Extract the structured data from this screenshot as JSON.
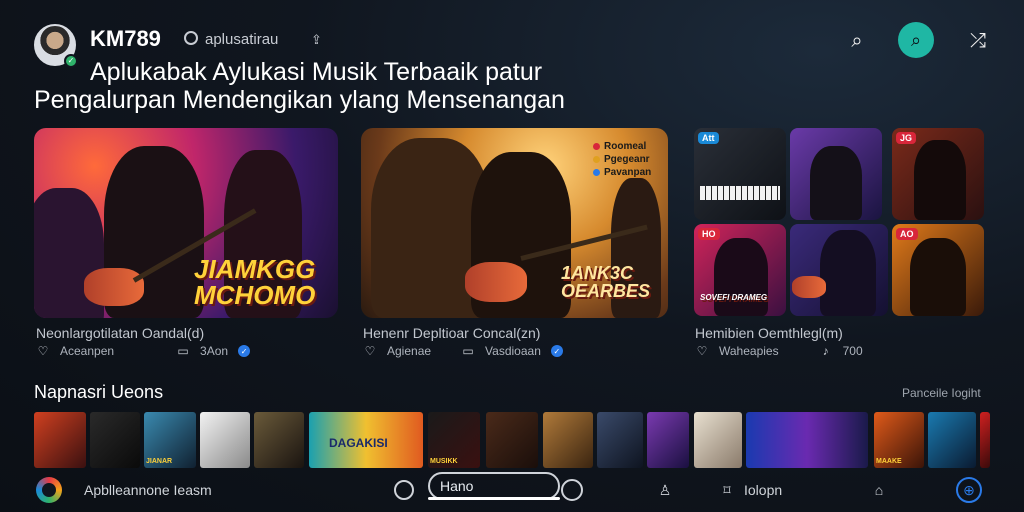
{
  "header": {
    "username": "KM789",
    "tagline": "aplusatirau",
    "headline_line1": "Aplukabak Aylukasi Musik Terbaaik patur",
    "headline_line2": "Pengalurpan Mendengikan ylang Mensenangan",
    "icons": [
      "search-icon",
      "discover-icon",
      "shuffle-icon"
    ]
  },
  "featured": [
    {
      "overlay": "JIAMKGG\nMCHOMO",
      "title": "Neonlargotilatan Oandal(d)",
      "left_meta": "Aceanpen",
      "right_meta": "3Aon"
    },
    {
      "overlay": "1ANK3C\nOEARBES",
      "chip_line1": "Roomeal",
      "chip_line2": "Pgegeanr",
      "chip_line3": "Pavanpan",
      "title": "Henenr Depltioar Concal(zn)",
      "left_meta": "Agienae",
      "right_meta": "Vasdioaan"
    },
    {
      "title": "Hemibien Oemthlegl(m)",
      "left_meta": "Waheapies",
      "right_meta": "700",
      "tiles": [
        {
          "badge": "Att"
        },
        {
          "badge": ""
        },
        {
          "badge": "JG"
        },
        {
          "badge": "HO",
          "label": "SOVEFI DRAMEG"
        },
        {
          "badge": ""
        },
        {
          "badge": "AO"
        }
      ]
    }
  ],
  "section": {
    "title": "Napnasri Ueons",
    "link": "Panceile Iogiht"
  },
  "strip": [
    {
      "label": ""
    },
    {
      "label": ""
    },
    {
      "label": "JIANAR"
    },
    {
      "label": ""
    },
    {
      "label": ""
    },
    {
      "label": "DAGAKISI"
    },
    {
      "label": "MUSIKK"
    },
    {
      "label": ""
    },
    {
      "label": ""
    },
    {
      "label": ""
    },
    {
      "label": ""
    },
    {
      "label": ""
    },
    {
      "label": ""
    },
    {
      "label": "MAAKE"
    },
    {
      "label": ""
    },
    {
      "label": ""
    },
    {
      "label": ""
    }
  ],
  "navbar": {
    "home_label": "Apblleannone Ieasm",
    "search_label": "Hano",
    "library_label": "Iolopn",
    "icons": [
      "app-logo-icon",
      "compass-icon",
      "search-icon",
      "ring-icon",
      "profile-icon",
      "bookmark-icon",
      "notification-icon",
      "globe-icon"
    ]
  },
  "colors": {
    "background": "#10161f",
    "accent": "#1fb7a4",
    "verified": "#2a7ae8",
    "overlay_text": "#ffd23a"
  }
}
